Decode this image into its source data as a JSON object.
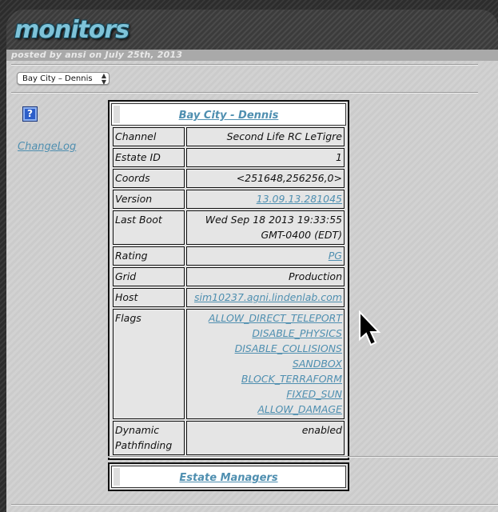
{
  "header": {
    "title": "monitors",
    "byline": "posted by ansi on July 25th, 2013"
  },
  "region_select": {
    "selected": "Bay City – Dennis"
  },
  "sidebar": {
    "help_icon": "?",
    "changelog": "ChangeLog"
  },
  "region_box": {
    "title": "Bay City - Dennis",
    "rows": [
      {
        "key": "Channel",
        "value": "Second Life RC LeTigre",
        "link": false
      },
      {
        "key": "Estate ID",
        "value": "1",
        "link": false
      },
      {
        "key": "Coords",
        "value": "<251648,256256,0>",
        "link": false
      },
      {
        "key": "Version",
        "value": "13.09.13.281045",
        "link": true
      },
      {
        "key": "Last Boot",
        "value": "Wed Sep 18 2013 19:33:55",
        "value2": "GMT-0400 (EDT)",
        "link": false
      },
      {
        "key": "Rating",
        "value": "PG",
        "link": true
      },
      {
        "key": "Grid",
        "value": "Production",
        "link": false
      },
      {
        "key": "Host",
        "value": "sim10237.agni.lindenlab.com",
        "link": true
      }
    ],
    "flags_key": "Flags",
    "flags": [
      "ALLOW_DIRECT_TELEPORT",
      "DISABLE_PHYSICS",
      "DISABLE_COLLISIONS",
      "SANDBOX",
      "BLOCK_TERRAFORM",
      "FIXED_SUN",
      "ALLOW_DAMAGE"
    ],
    "pathfinding_key_1": "Dynamic",
    "pathfinding_key_2": "Pathfinding",
    "pathfinding_value": "enabled"
  },
  "estate_box": {
    "title": "Estate Managers"
  }
}
